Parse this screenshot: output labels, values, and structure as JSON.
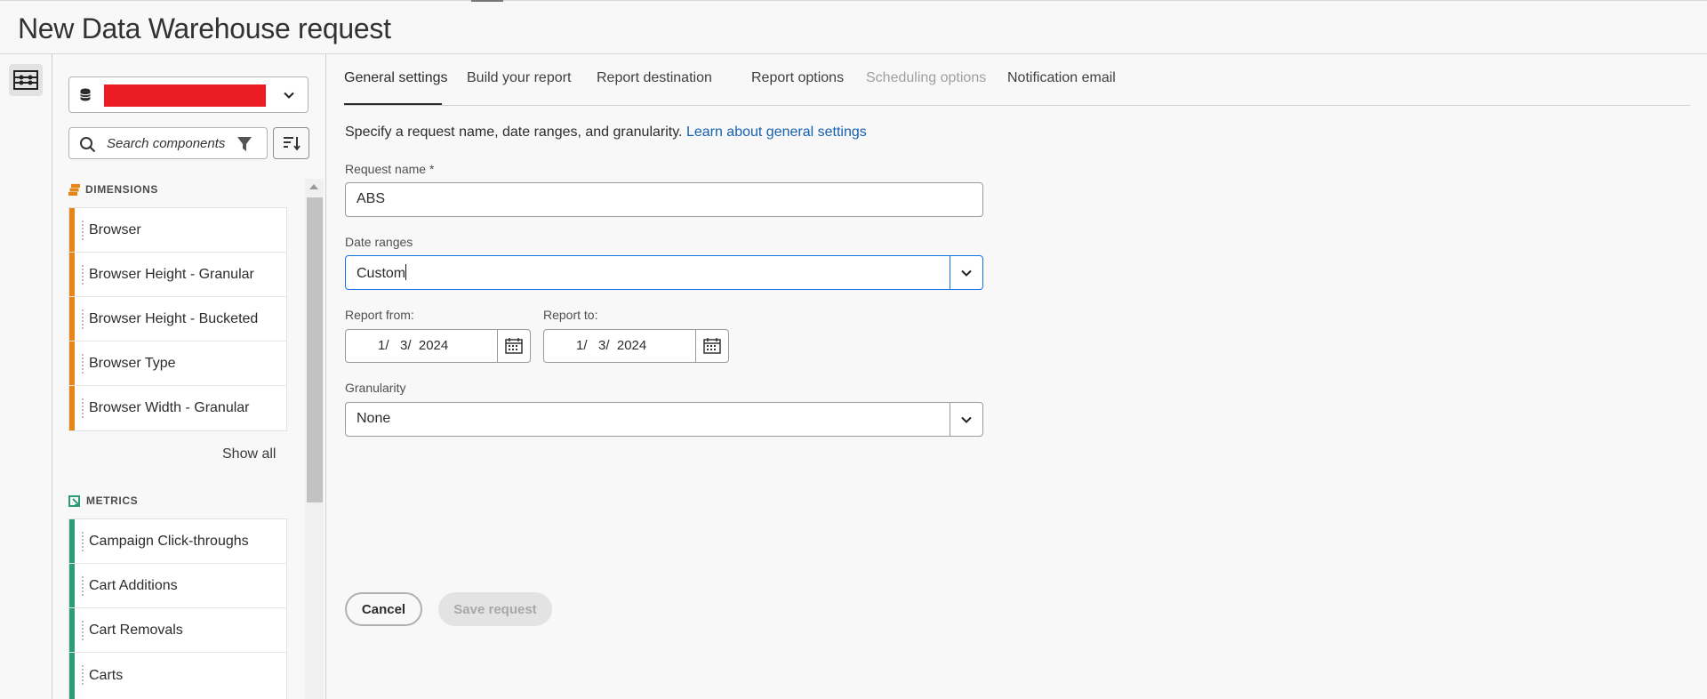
{
  "header": {
    "title": "New Data Warehouse request"
  },
  "left_panel": {
    "search_placeholder": "Search components",
    "dimensions": {
      "title": "DIMENSIONS",
      "items": [
        "Browser",
        "Browser Height - Granular",
        "Browser Height - Bucketed",
        "Browser Type",
        "Browser Width - Granular"
      ],
      "show_all": "Show all",
      "color": "#e68619"
    },
    "metrics": {
      "title": "METRICS",
      "items": [
        "Campaign Click-throughs",
        "Cart Additions",
        "Cart Removals",
        "Carts"
      ],
      "color": "#2d9d78"
    }
  },
  "tabs": [
    {
      "label": "General settings",
      "state": "active"
    },
    {
      "label": "Build your report",
      "state": "normal"
    },
    {
      "label": "Report destination",
      "state": "normal"
    },
    {
      "label": "Report options",
      "state": "normal"
    },
    {
      "label": "Scheduling options",
      "state": "disabled"
    },
    {
      "label": "Notification email",
      "state": "normal"
    }
  ],
  "form": {
    "description": "Specify a request name, date ranges, and granularity.",
    "learn_link": "Learn about general settings",
    "request_name_label": "Request name",
    "required_mark": "*",
    "request_name_value": "ABS",
    "date_ranges_label": "Date ranges",
    "date_ranges_value": "Custom",
    "report_from_label": "Report from:",
    "report_from_value": "1/   3/  2024",
    "report_to_label": "Report to:",
    "report_to_value": "1/   3/  2024",
    "granularity_label": "Granularity",
    "granularity_value": "None"
  },
  "actions": {
    "cancel": "Cancel",
    "save": "Save request"
  },
  "icons": {
    "rail": "panel-toggle-icon",
    "data_source": "database-icon",
    "search": "search-icon",
    "filter": "filter-icon",
    "sort": "sort-icon",
    "calendar": "calendar-icon",
    "chevron": "chevron-down-icon"
  },
  "colors": {
    "link": "#1560b0",
    "focus": "#1473e6",
    "redaction": "#ec1c24"
  }
}
